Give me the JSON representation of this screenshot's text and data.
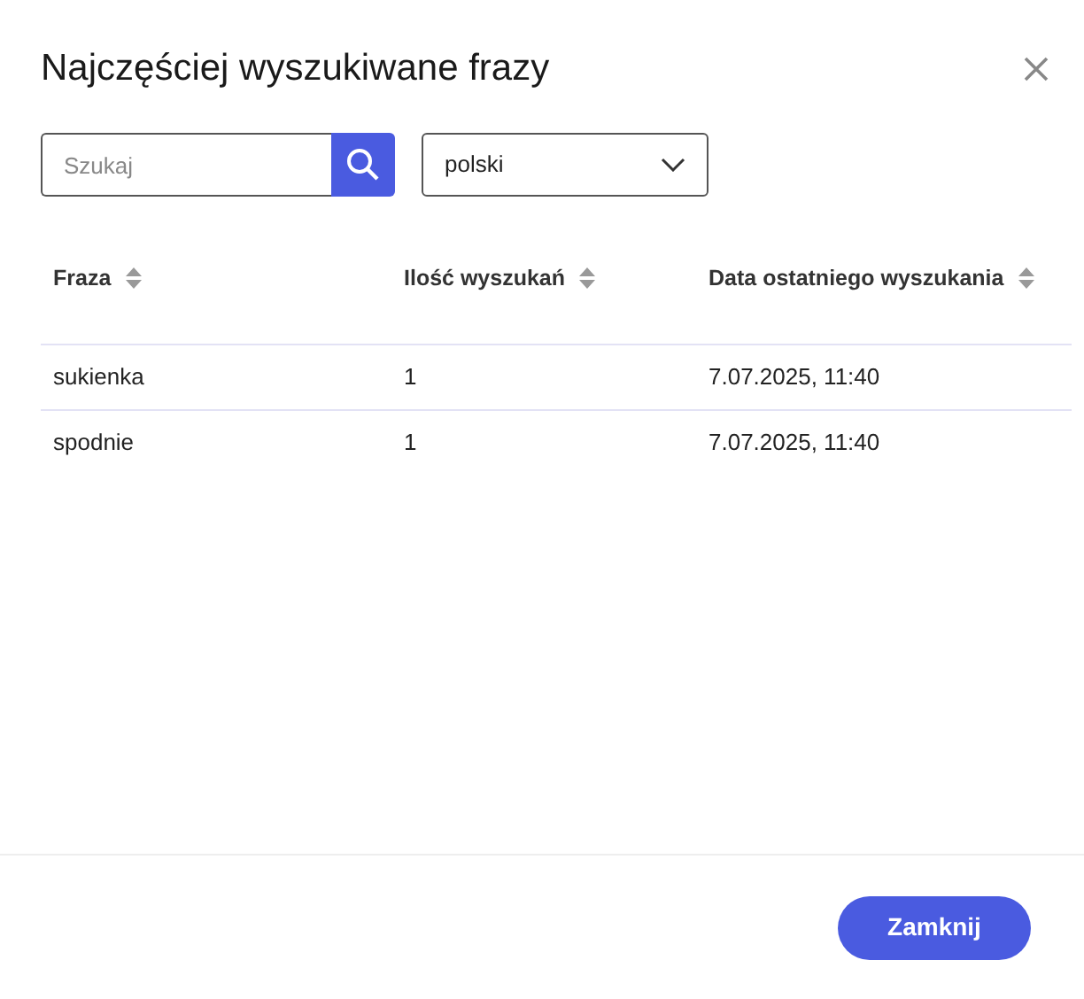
{
  "title": "Najczęściej wyszukiwane frazy",
  "search": {
    "placeholder": "Szukaj"
  },
  "language": {
    "value": "polski"
  },
  "table": {
    "columns": [
      "Fraza",
      "Ilość wyszukań",
      "Data ostatniego wyszukania"
    ],
    "rows": [
      [
        "sukienka",
        "1",
        "7.07.2025, 11:40"
      ],
      [
        "spodnie",
        "1",
        "7.07.2025, 11:40"
      ]
    ]
  },
  "buttons": [
    "Zamknij"
  ]
}
